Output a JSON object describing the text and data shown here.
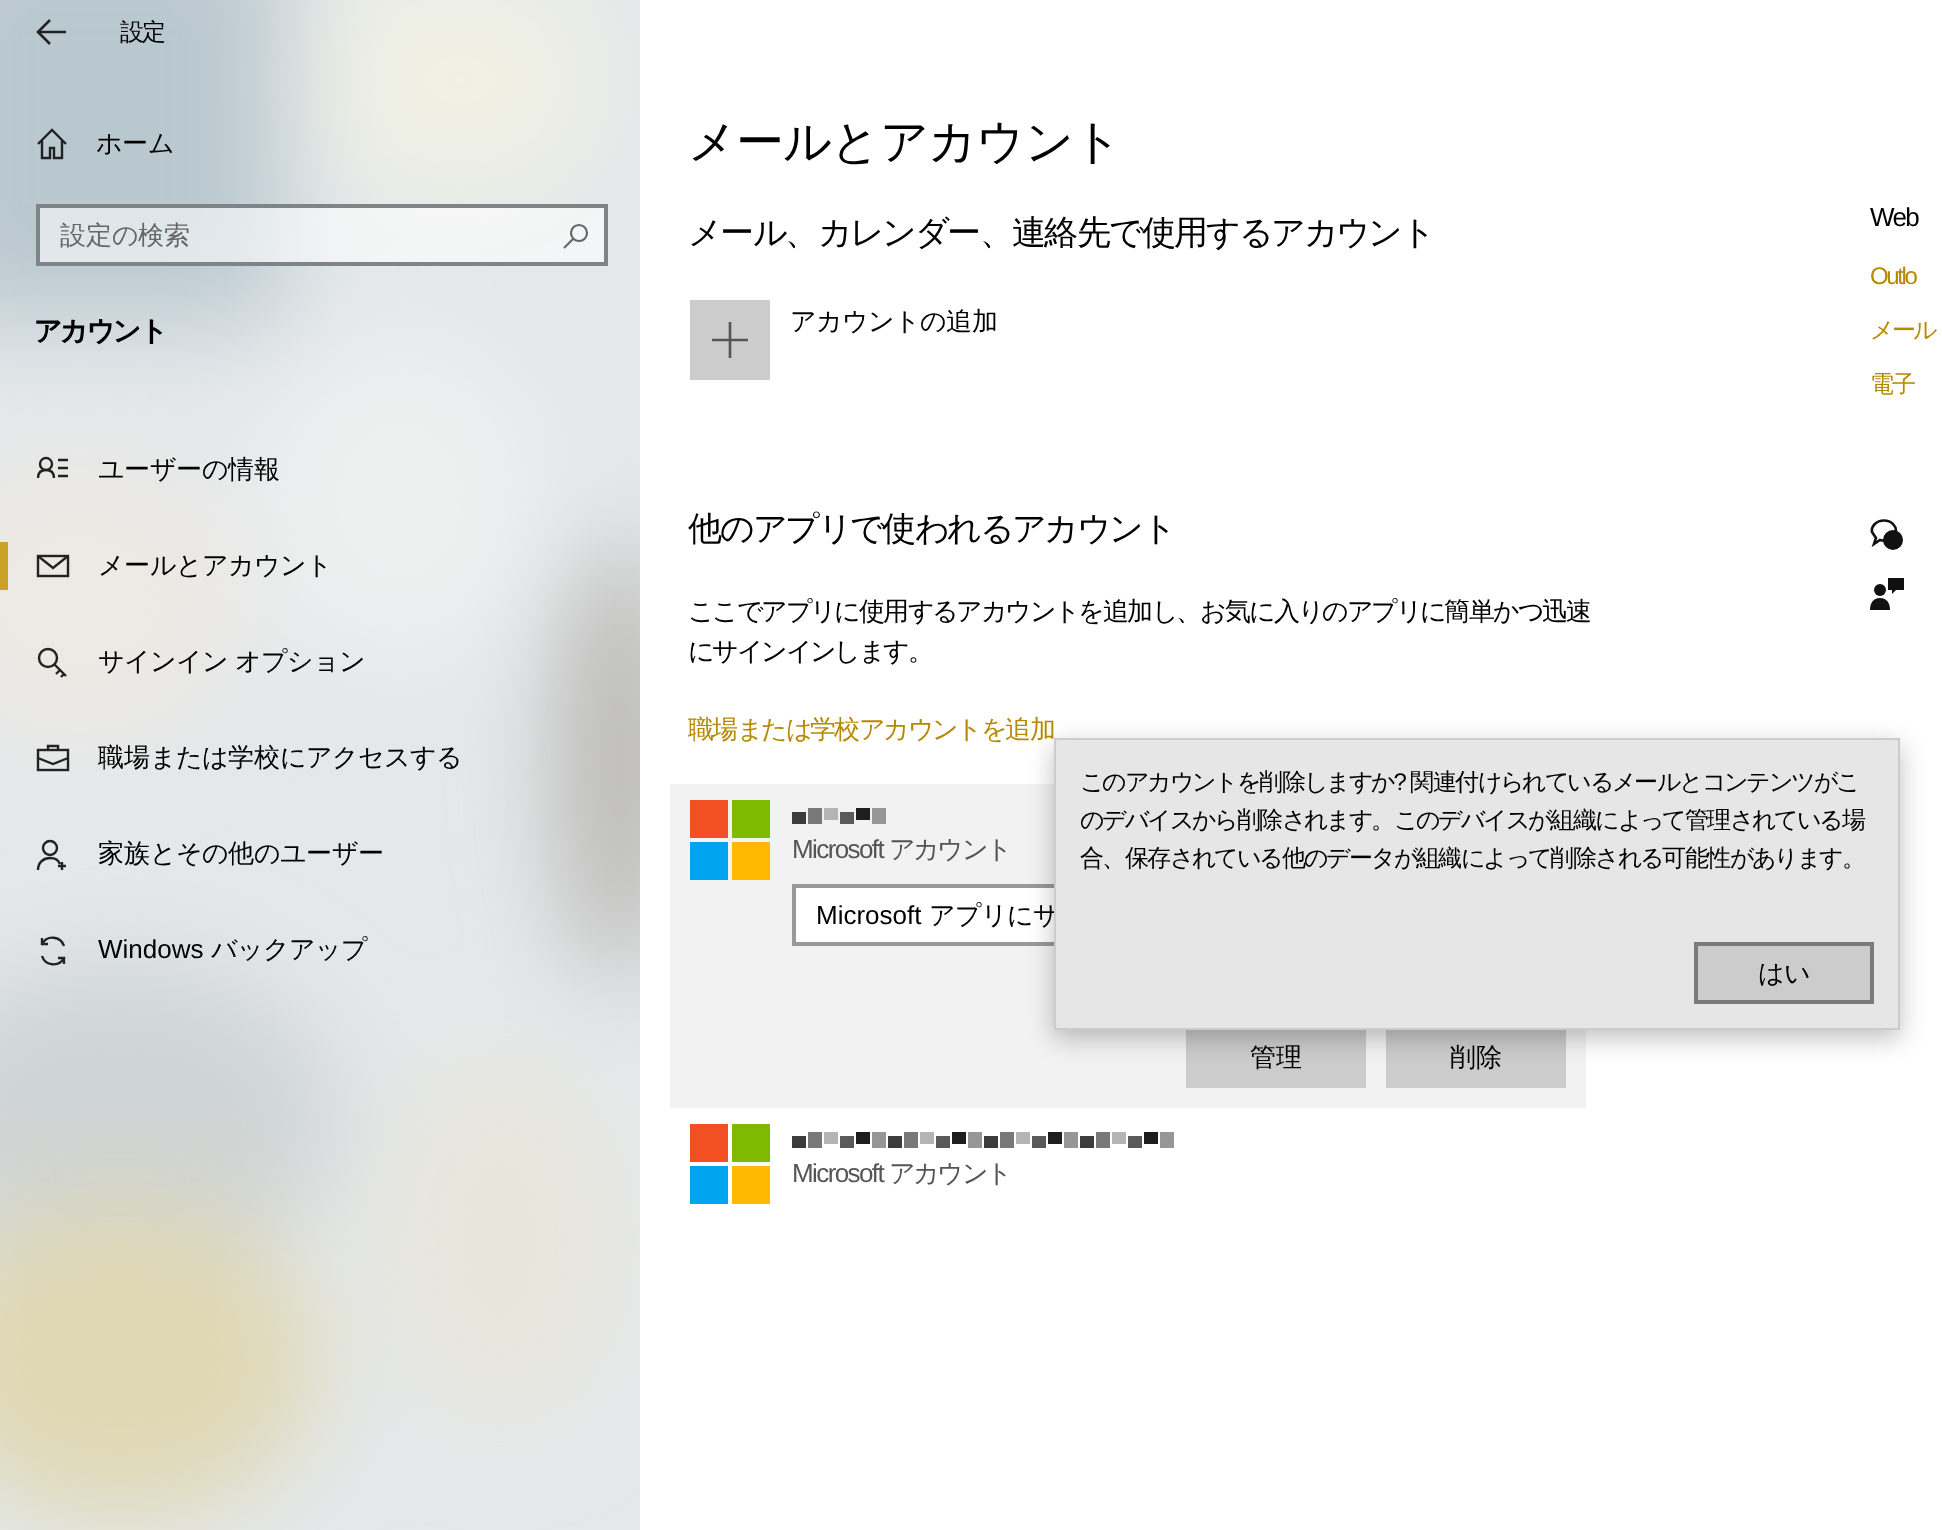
{
  "window": {
    "title": "設定"
  },
  "sidebar": {
    "home": "ホーム",
    "search": {
      "placeholder": "設定の検索"
    },
    "section": "アカウント",
    "items": [
      {
        "label": "ユーザーの情報",
        "selected": false
      },
      {
        "label": "メールとアカウント",
        "selected": true
      },
      {
        "label": "サインイン オプション",
        "selected": false
      },
      {
        "label": "職場または学校にアクセスする",
        "selected": false
      },
      {
        "label": "家族とその他のユーザー",
        "selected": false
      },
      {
        "label": "Windows バックアップ",
        "selected": false
      }
    ]
  },
  "main": {
    "title": "メールとアカウント",
    "email_heading": "メール、カレンダー、連絡先で使用するアカウント",
    "add_account": "アカウントの追加",
    "other_heading": "他のアプリで使われるアカウント",
    "other_description": "ここでアプリに使用するアカウントを追加し、お気に入りのアプリに簡単かつ迅速にサインインします。",
    "work_link": "職場または学校アカウントを追加",
    "accounts": [
      {
        "type": "Microsoft アカウント",
        "expanded": true,
        "dropdown": "Microsoft アプリにサ",
        "buttons": [
          "管理",
          "削除"
        ]
      },
      {
        "type": "Microsoft アカウント",
        "expanded": false
      }
    ]
  },
  "right_panel": {
    "heading": "Web",
    "links": [
      "Outlo",
      "メール",
      "電子"
    ]
  },
  "dialog": {
    "message": "このアカウントを削除しますか? 関連付けられているメールとコンテンツがこのデバイスから削除されます。このデバイスが組織によって管理されている場合、保存されている他のデータが組織によって削除される可能性があります。",
    "button": "はい"
  }
}
